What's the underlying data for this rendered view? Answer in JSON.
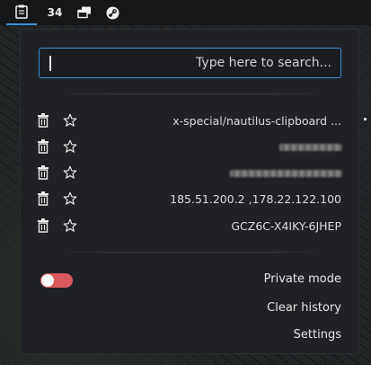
{
  "panel": {
    "tray_count": "34"
  },
  "search": {
    "placeholder": "Type here to search..."
  },
  "history": [
    {
      "text": "x-special/nautilus-clipboard ...",
      "redacted": false
    },
    {
      "text": "",
      "redacted": true
    },
    {
      "text": "",
      "redacted": true
    },
    {
      "text": "185.51.200.2 ,178.22.122.100",
      "redacted": false
    },
    {
      "text": "GCZ6C-X4IKY-6JHEP",
      "redacted": false
    }
  ],
  "controls": {
    "private_mode_label": "Private mode",
    "private_mode_enabled": false,
    "clear_history_label": "Clear history",
    "settings_label": "Settings"
  },
  "colors": {
    "accent": "#3d8fd6",
    "toggle_off": "#d9595c"
  },
  "icons": [
    "clipboard-icon",
    "windows-icon",
    "steam-icon",
    "trash-icon",
    "star-icon"
  ]
}
